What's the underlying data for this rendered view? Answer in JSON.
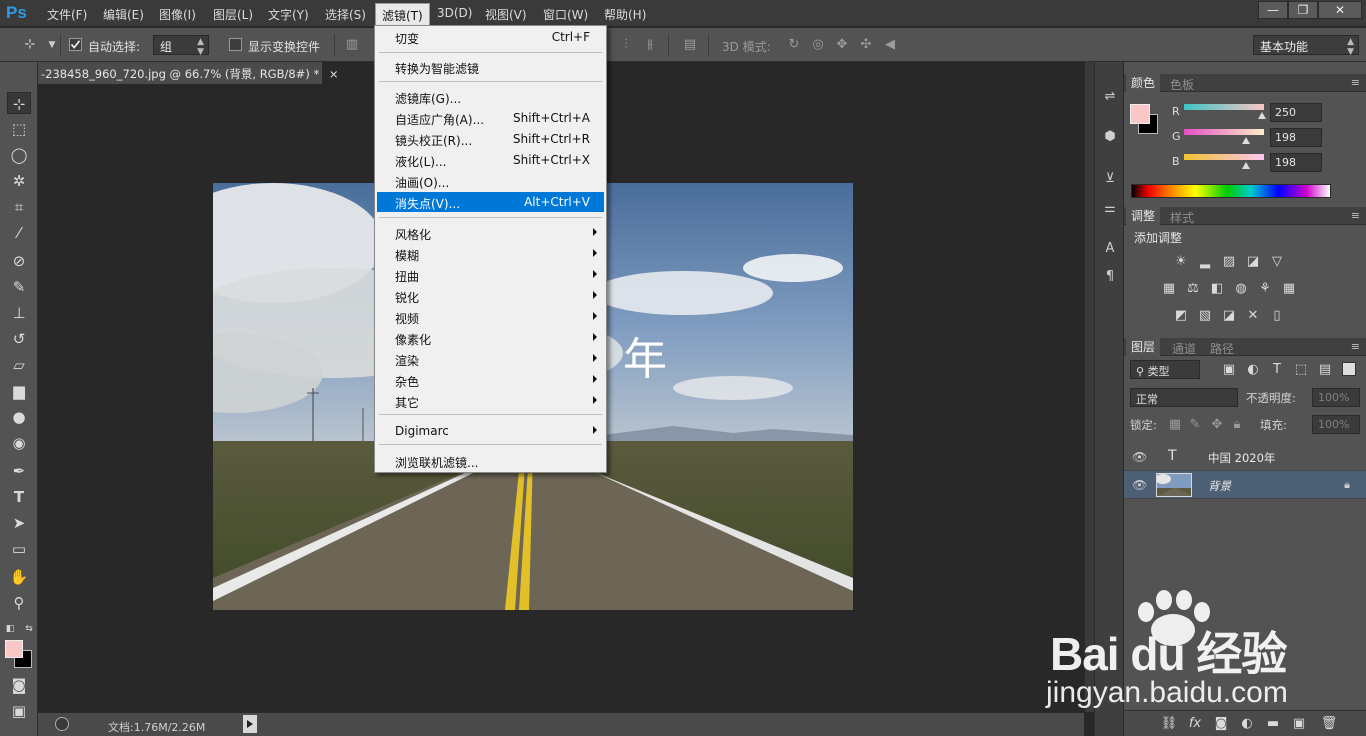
{
  "app": {
    "logo": "Ps"
  },
  "menubar": {
    "items": [
      "文件(F)",
      "编辑(E)",
      "图像(I)",
      "图层(L)",
      "文字(Y)",
      "选择(S)",
      "滤镜(T)",
      "3D(D)",
      "视图(V)",
      "窗口(W)",
      "帮助(H)"
    ],
    "window_buttons": [
      "—",
      "❐",
      "✕"
    ]
  },
  "options_bar": {
    "auto_select_label": "自动选择:",
    "auto_select_value": "组",
    "show_transform_label": "显示变换控件",
    "mode_3d_label": "3D 模式:",
    "workspace": "基本功能"
  },
  "document": {
    "tab_title": "-238458_960_720.jpg @ 66.7% (背景, RGB/8#) *",
    "close": "×",
    "canvas_text": "年",
    "status": "文档:1.76M/2.26M"
  },
  "filter_menu": {
    "items": [
      {
        "label": "切变",
        "shortcut": "Ctrl+F"
      },
      {
        "label": "转换为智能滤镜"
      },
      {
        "label": "滤镜库(G)..."
      },
      {
        "label": "自适应广角(A)...",
        "shortcut": "Shift+Ctrl+A"
      },
      {
        "label": "镜头校正(R)...",
        "shortcut": "Shift+Ctrl+R"
      },
      {
        "label": "液化(L)...",
        "shortcut": "Shift+Ctrl+X"
      },
      {
        "label": "油画(O)..."
      },
      {
        "label": "消失点(V)...",
        "shortcut": "Alt+Ctrl+V",
        "highlighted": true
      },
      {
        "label": "风格化"
      },
      {
        "label": "模糊"
      },
      {
        "label": "扭曲"
      },
      {
        "label": "锐化"
      },
      {
        "label": "视频"
      },
      {
        "label": "像素化"
      },
      {
        "label": "渲染"
      },
      {
        "label": "杂色"
      },
      {
        "label": "其它"
      },
      {
        "label": "Digimarc"
      },
      {
        "label": "浏览联机滤镜..."
      }
    ]
  },
  "color_panel": {
    "tabs": [
      "颜色",
      "色板"
    ],
    "channels": [
      {
        "label": "R",
        "value": "250",
        "fraction": 0.98
      },
      {
        "label": "G",
        "value": "198",
        "fraction": 0.776
      },
      {
        "label": "B",
        "value": "198",
        "fraction": 0.776
      }
    ],
    "foreground_color": "#fac6c6",
    "background_color": "#000000"
  },
  "adjustments_panel": {
    "tabs": [
      "调整",
      "样式"
    ],
    "title": "添加调整"
  },
  "layers_panel": {
    "tabs": [
      "图层",
      "通道",
      "路径"
    ],
    "filter_kind": "类型",
    "blend_mode": "正常",
    "opacity_label": "不透明度:",
    "opacity_value": "100%",
    "lock_label": "锁定:",
    "fill_label": "填充:",
    "fill_value": "100%",
    "layers": [
      {
        "type_icon": "T",
        "name": "中国 2020年",
        "selected": false
      },
      {
        "name": "背景",
        "selected": true
      }
    ]
  },
  "watermark": {
    "brand": "Bai du 经验",
    "url": "jingyan.baidu.com"
  }
}
